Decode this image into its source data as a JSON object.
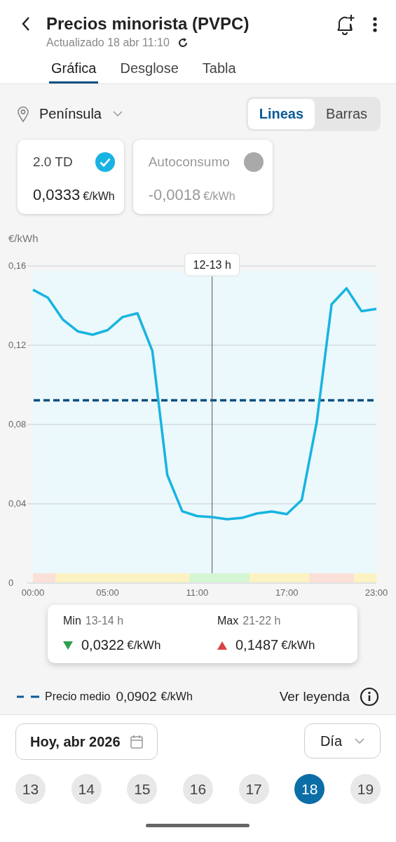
{
  "header": {
    "title": "Precios minorista (PVPC)",
    "subtitle": "Actualizado 18 abr 11:10"
  },
  "tabs": [
    {
      "label": "Gráfica",
      "selected": true
    },
    {
      "label": "Desglose",
      "selected": false
    },
    {
      "label": "Tabla",
      "selected": false
    }
  ],
  "region": {
    "label": "Península"
  },
  "view_toggle": [
    {
      "label": "Lineas",
      "selected": true
    },
    {
      "label": "Barras",
      "selected": false
    }
  ],
  "tariffs": [
    {
      "name": "2.0 TD",
      "value": "0,0333",
      "unit": "€/kWh",
      "checked": true
    },
    {
      "name": "Autoconsumo",
      "value": "-0,0018",
      "unit": "€/kWh",
      "checked": false
    }
  ],
  "chart": {
    "unit_label": "€/kWh",
    "chart_data": {
      "type": "line",
      "x": [
        0,
        1,
        2,
        3,
        4,
        5,
        6,
        7,
        8,
        9,
        10,
        11,
        12,
        13,
        14,
        15,
        16,
        17,
        18,
        19,
        20,
        21,
        22,
        23
      ],
      "series": [
        {
          "color": "#17b4e0",
          "values": [
            0.148,
            0.144,
            0.133,
            0.127,
            0.1253,
            0.1276,
            0.1342,
            0.1361,
            0.1171,
            0.0545,
            0.0362,
            0.0338,
            0.0333,
            0.0322,
            0.0329,
            0.0351,
            0.0361,
            0.0348,
            0.0419,
            0.081,
            0.1406,
            0.1487,
            0.1372,
            0.1383
          ]
        }
      ],
      "xlim": [
        0,
        23
      ],
      "ylim": [
        0,
        0.16
      ],
      "xticks": [
        {
          "value": 0,
          "label": "00:00"
        },
        {
          "value": 5,
          "label": "05:00"
        },
        {
          "value": 11,
          "label": "11:00"
        },
        {
          "value": 17,
          "label": "17:00"
        },
        {
          "value": 23,
          "label": "23:00"
        }
      ],
      "yticks": [
        {
          "value": 0,
          "label": "0"
        },
        {
          "value": 0.04,
          "label": "0,04"
        },
        {
          "value": 0.08,
          "label": "0,08"
        },
        {
          "value": 0.12,
          "label": "0,12"
        },
        {
          "value": 0.16,
          "label": "0,16"
        }
      ],
      "grid": true,
      "ref_lines": [
        {
          "axis": "y",
          "value": 0.0922,
          "color": "#0b4f80"
        },
        {
          "axis": "x",
          "value": 12,
          "label": "12-13 h"
        }
      ]
    },
    "hour_periods": [
      {
        "color": "#fbe0d8"
      },
      {
        "color": "#fbe0d8"
      },
      {
        "color": "#fcf2c2"
      },
      {
        "color": "#fcf2c2"
      },
      {
        "color": "#fcf2c2"
      },
      {
        "color": "#fcf2c2"
      },
      {
        "color": "#fcf2c2"
      },
      {
        "color": "#fcf2c2"
      },
      {
        "color": "#fcf2c2"
      },
      {
        "color": "#fcf2c2"
      },
      {
        "color": "#fcf2c2"
      },
      {
        "color": "#d4f6d2"
      },
      {
        "color": "#d4f6d2"
      },
      {
        "color": "#d4f6d2"
      },
      {
        "color": "#d4f6d2"
      },
      {
        "color": "#fcf2c2"
      },
      {
        "color": "#fcf2c2"
      },
      {
        "color": "#fcf2c2"
      },
      {
        "color": "#fcf2c2"
      },
      {
        "color": "#fbe0d8"
      },
      {
        "color": "#fbe0d8"
      },
      {
        "color": "#fbe0d8"
      },
      {
        "color": "#fcf2c2"
      },
      {
        "color": "#fcf2c2"
      }
    ]
  },
  "summary": [
    {
      "kind": "min",
      "label": "Min",
      "hours": "13-14 h",
      "value": "0,0322",
      "unit": "€/kWh"
    },
    {
      "kind": "max",
      "label": "Max",
      "hours": "21-22 h",
      "value": "0,1487",
      "unit": "€/kWh"
    }
  ],
  "legend": {
    "label": "Precio medio",
    "value": "0,0902",
    "unit": "€/kWh",
    "link": "Ver leyenda"
  },
  "date_button": "Hoy, abr 2026",
  "period_select": "Día",
  "days": [
    {
      "label": "13",
      "selected": false
    },
    {
      "label": "14",
      "selected": false
    },
    {
      "label": "15",
      "selected": false
    },
    {
      "label": "16",
      "selected": false
    },
    {
      "label": "17",
      "selected": false
    },
    {
      "label": "18",
      "selected": true
    },
    {
      "label": "19",
      "selected": false
    }
  ]
}
